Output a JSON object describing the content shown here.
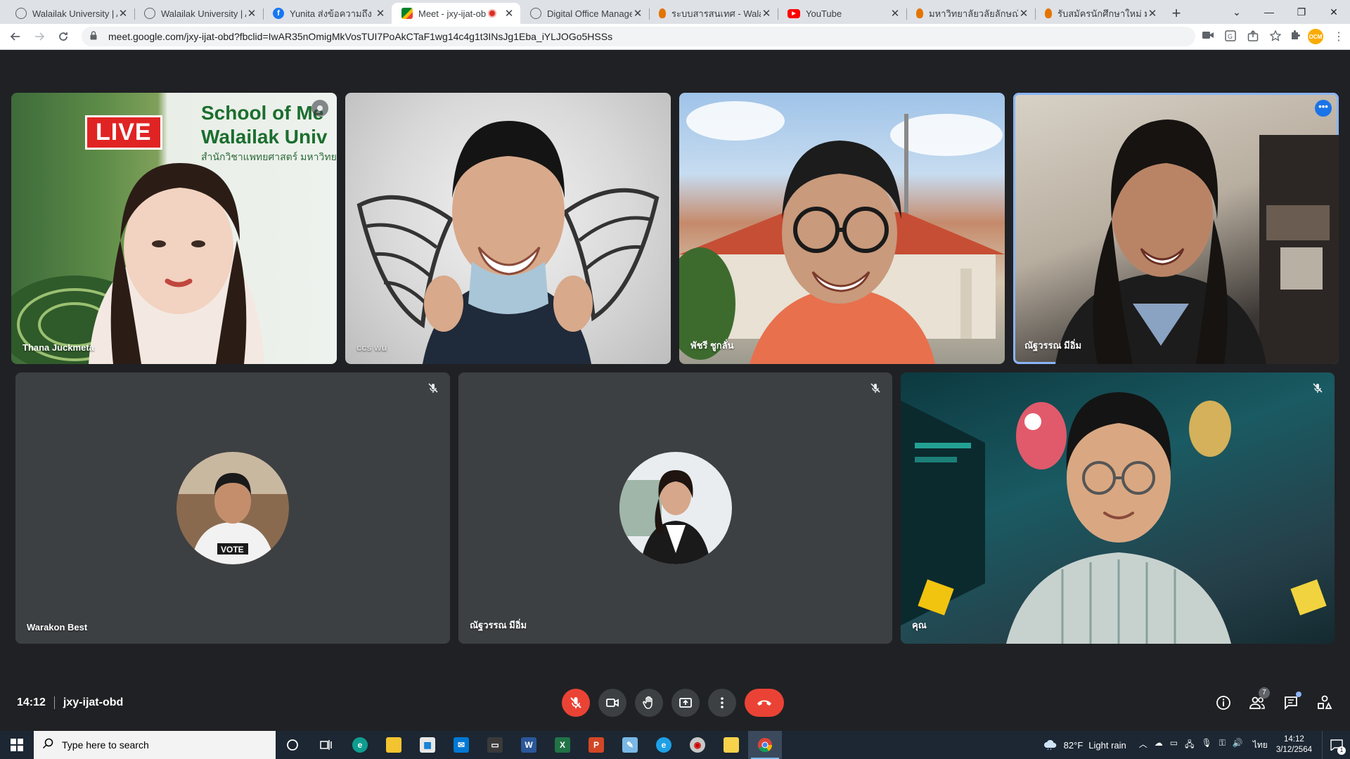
{
  "browser": {
    "tabs": [
      {
        "title": "Walailak University | A",
        "favicon": "globe-icon",
        "color": "#5f6368",
        "active": false
      },
      {
        "title": "Walailak University | A",
        "favicon": "globe-icon",
        "color": "#5f6368",
        "active": false
      },
      {
        "title": "Yunita ส่งข้อความถึง ลูก",
        "favicon": "facebook-icon",
        "color": "#1877f2",
        "active": false
      },
      {
        "title": "Meet - jxy-ijat-ob",
        "favicon": "google-meet-icon",
        "color": "#00832d",
        "active": true,
        "recording": true
      },
      {
        "title": "Digital Office Manage",
        "favicon": "globe-icon",
        "color": "#5f6368",
        "active": false
      },
      {
        "title": "ระบบสารสนเทศ - Walail",
        "favicon": "wu-icon",
        "color": "#e37400",
        "active": false
      },
      {
        "title": "YouTube",
        "favicon": "youtube-icon",
        "color": "#ff0000",
        "active": false
      },
      {
        "title": "มหาวิทยาลัยวลัยลักษณ์",
        "favicon": "wu-icon",
        "color": "#e37400",
        "active": false
      },
      {
        "title": "รับสมัครนักศึกษาใหม่ มห",
        "favicon": "wu-icon",
        "color": "#e37400",
        "active": false
      }
    ],
    "new_tab_label": "+",
    "url": "meet.google.com/jxy-ijat-obd?fbclid=IwAR35nOmigMkVosTUI7PoAkCTaF1wg14c4g1t3INsJg1Eba_iYLJOGo5HSSs",
    "profile_initials": "OCM"
  },
  "meet": {
    "time": "14:12",
    "meeting_code": "jxy-ijat-obd",
    "participant_count": "7",
    "tiles": [
      {
        "name": "Thana Juckmeta",
        "video": "live-studio"
      },
      {
        "name": "ccs wu",
        "video": "wings-wall"
      },
      {
        "name": "พัชรี ชูกลั่น",
        "video": "temple"
      },
      {
        "name": "ณัฐวรรณ มีอิ่ม",
        "video": "room",
        "speaking": true
      },
      {
        "name": "Warakon Best",
        "video": "avatar",
        "muted": true
      },
      {
        "name": "ณัฐวรรณ มีอิ่ม",
        "video": "avatar",
        "muted": true
      },
      {
        "name": "คุณ",
        "video": "spaceship",
        "muted": true
      }
    ],
    "live_sign": {
      "badge": "LIVE",
      "line1": "School of Me",
      "line2": "Walailak Univ",
      "line3": "สำนักวิชาแพทยศาสตร์ มหาวิทย"
    }
  },
  "taskbar": {
    "search_placeholder": "Type here to search",
    "weather_temp": "82°F",
    "weather_desc": "Light rain",
    "language": "ไทย",
    "clock_time": "14:12",
    "clock_date": "3/12/2564",
    "notification_count": "1"
  }
}
